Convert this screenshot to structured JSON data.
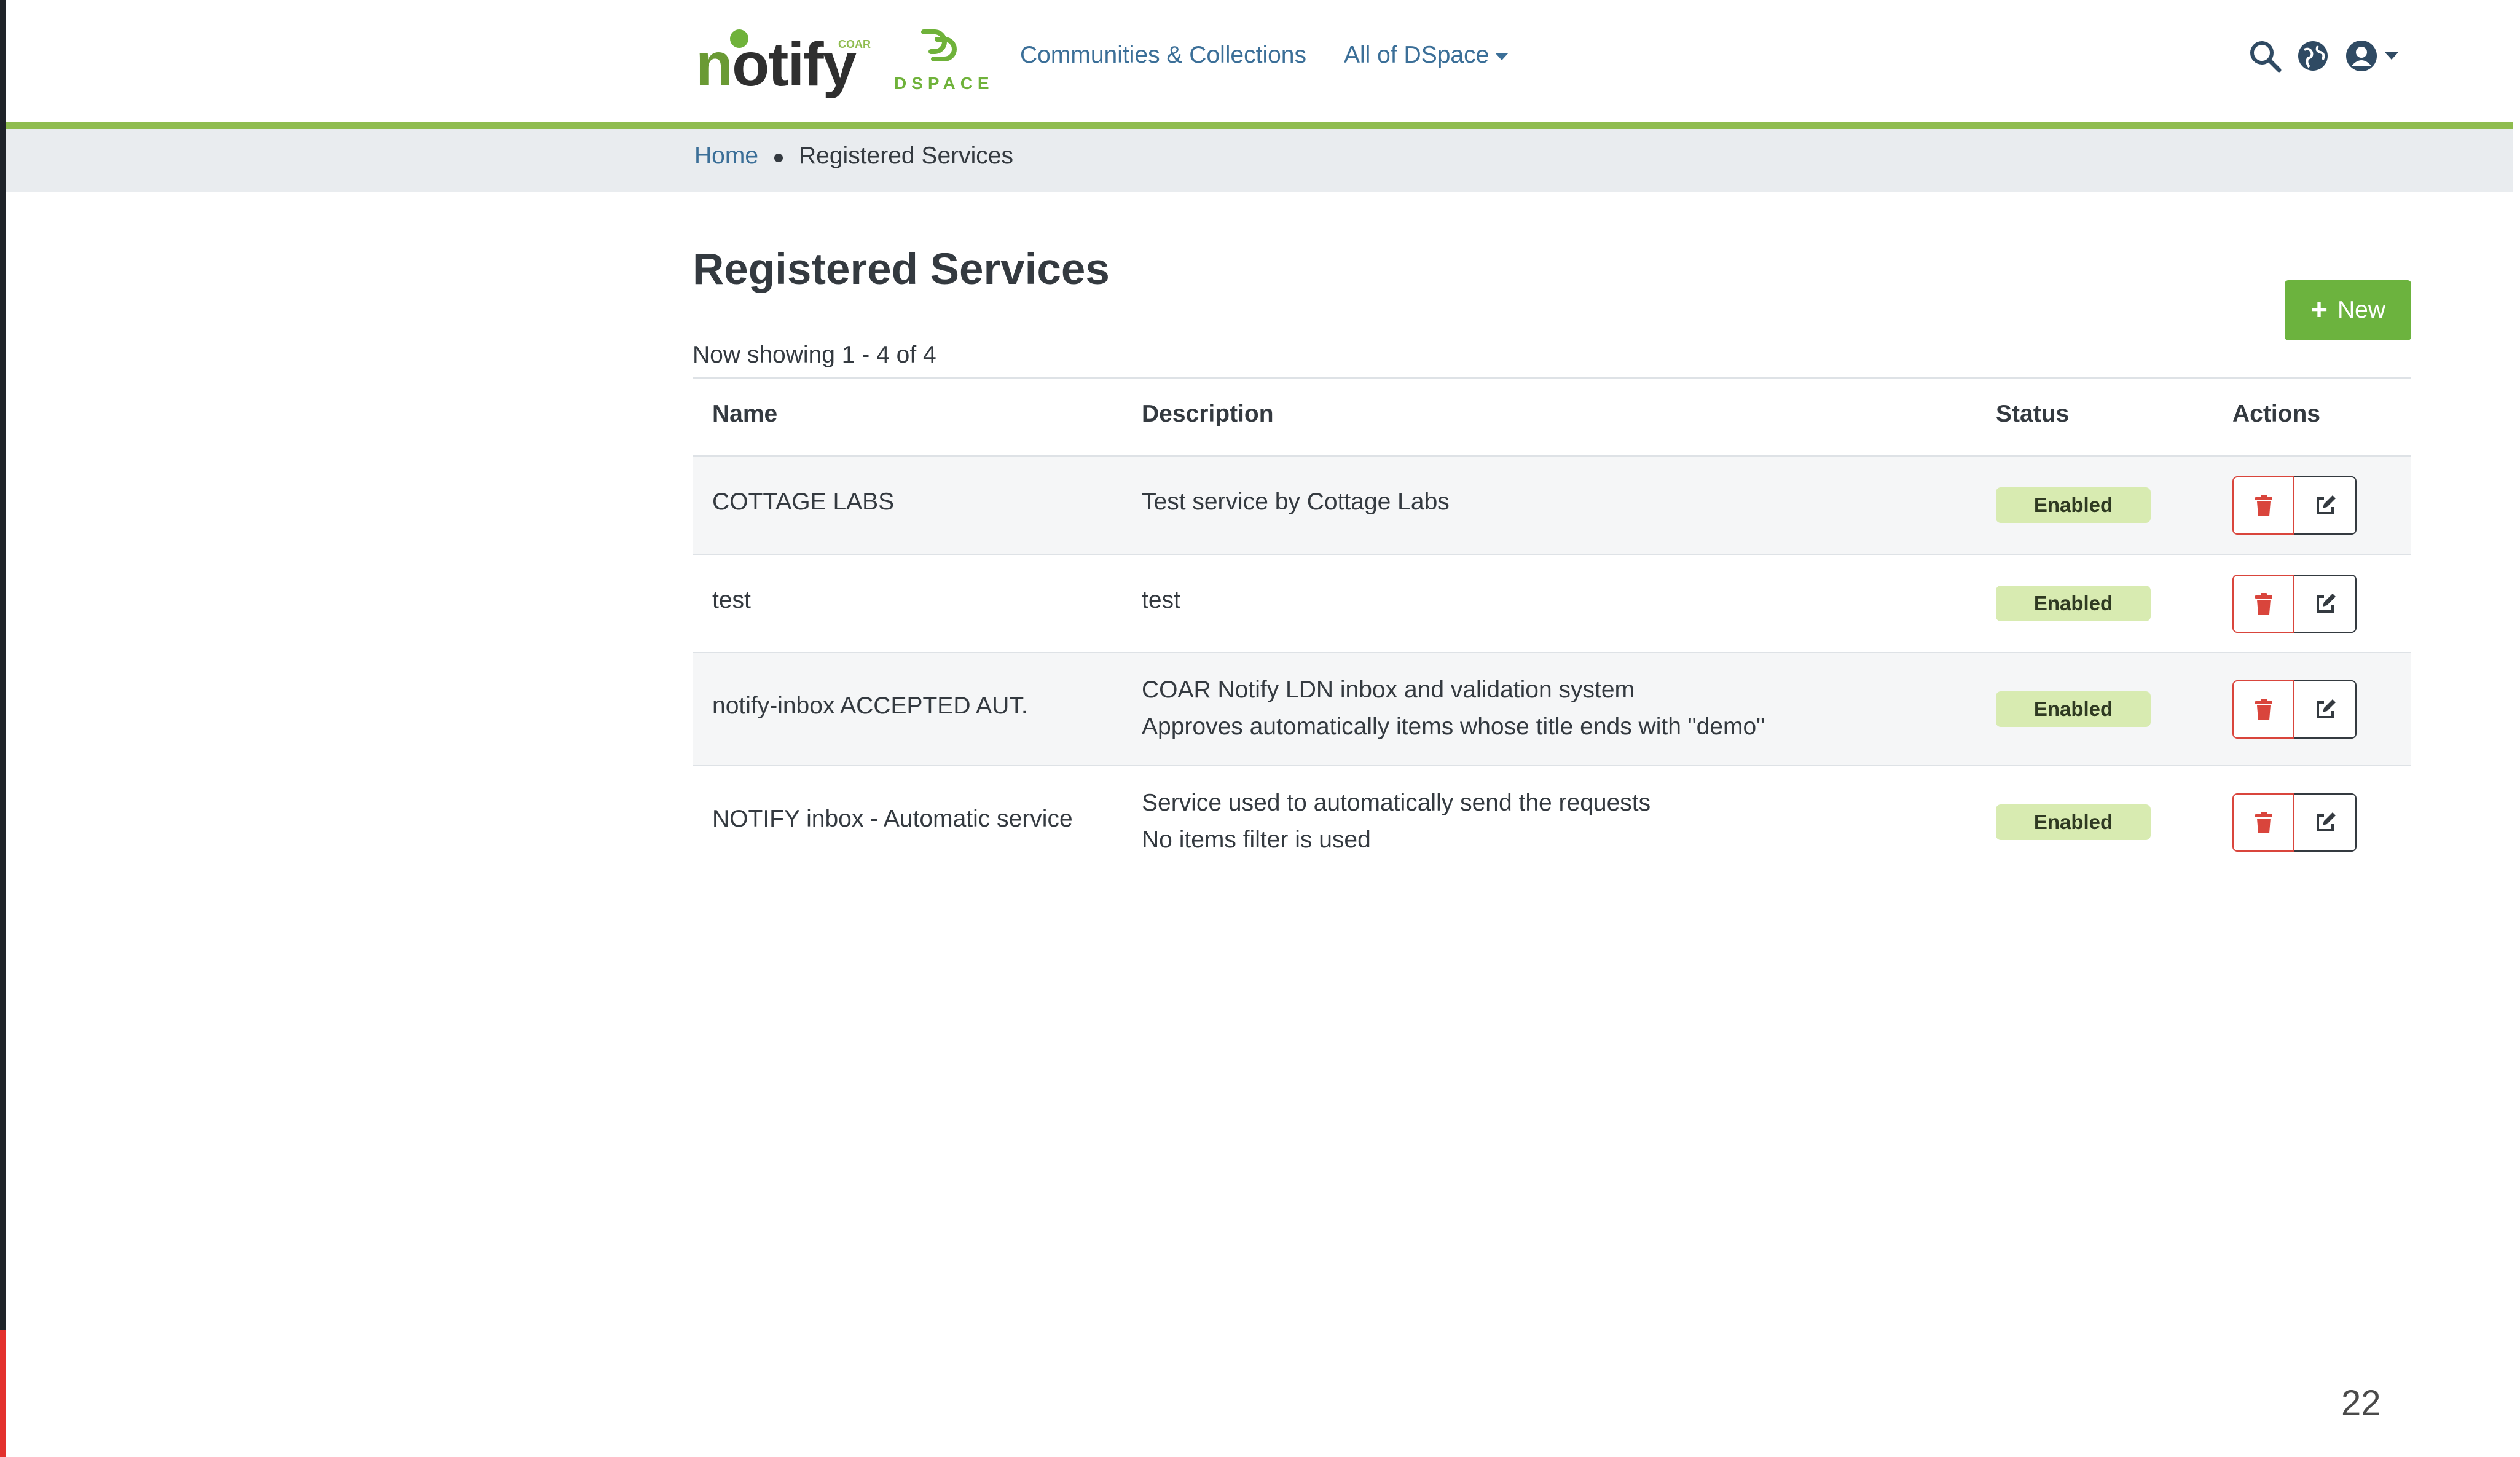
{
  "brand": {
    "logo_text_n": "n",
    "logo_text_rest": "otify",
    "logo_badge": "COAR",
    "dspace_text": "DSPACE",
    "accent_green": "#6cb33e",
    "link_blue": "#3b6f98"
  },
  "nav": {
    "communities": "Communities & Collections",
    "all_dspace": "All of DSpace"
  },
  "header_icons": [
    "search-icon",
    "language-globe-icon",
    "user-account-icon"
  ],
  "breadcrumb": {
    "home": "Home",
    "current": "Registered Services"
  },
  "page": {
    "title": "Registered Services",
    "new_button": "New",
    "showing": "Now showing 1 - 4 of 4"
  },
  "table": {
    "headers": [
      "Name",
      "Description",
      "Status",
      "Actions"
    ],
    "rows": [
      {
        "name": "COTTAGE LABS",
        "description": [
          "Test service by Cottage Labs"
        ],
        "status": "Enabled"
      },
      {
        "name": "test",
        "description": [
          "test"
        ],
        "status": "Enabled"
      },
      {
        "name": "notify-inbox ACCEPTED AUT.",
        "description": [
          "COAR Notify LDN inbox and validation system",
          "Approves automatically items whose title ends with \"demo\""
        ],
        "status": "Enabled"
      },
      {
        "name": "NOTIFY inbox - Automatic service",
        "description": [
          "Service used to automatically send the requests",
          "No items filter is used"
        ],
        "status": "Enabled"
      }
    ]
  },
  "slide_number": "22"
}
